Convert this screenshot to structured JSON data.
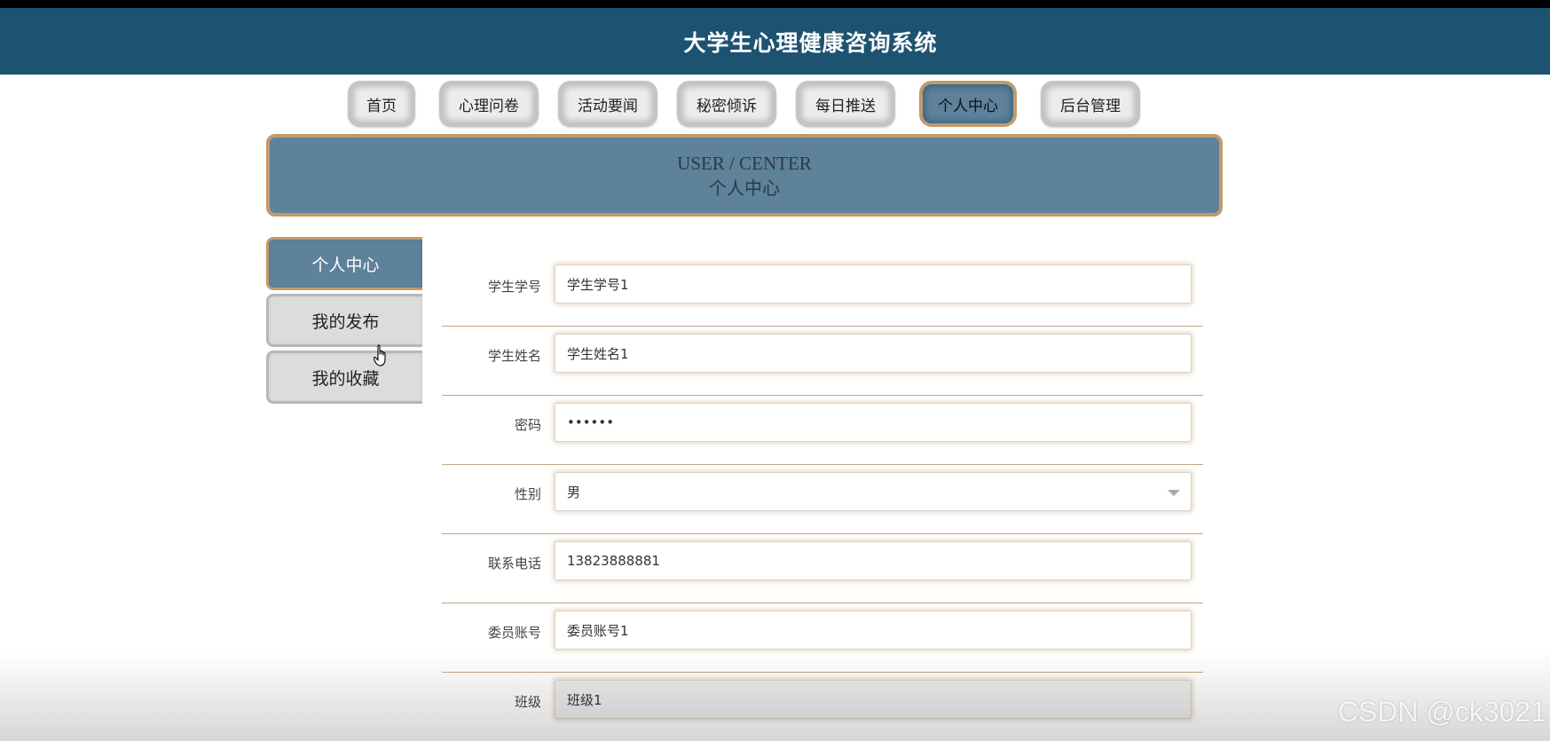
{
  "app": {
    "title": "大学生心理健康咨询系统"
  },
  "nav": {
    "items": [
      {
        "label": "首页"
      },
      {
        "label": "心理问卷"
      },
      {
        "label": "活动要闻"
      },
      {
        "label": "秘密倾诉"
      },
      {
        "label": "每日推送"
      },
      {
        "label": "个人中心",
        "active": true
      },
      {
        "label": "后台管理"
      }
    ]
  },
  "banner": {
    "en": "USER / CENTER",
    "cn": "个人中心"
  },
  "sidebar": {
    "items": [
      {
        "label": "个人中心",
        "active": true
      },
      {
        "label": "我的发布"
      },
      {
        "label": "我的收藏"
      }
    ]
  },
  "form": {
    "fields": [
      {
        "label": "学生学号",
        "value": "学生学号1"
      },
      {
        "label": "学生姓名",
        "value": "学生姓名1"
      },
      {
        "label": "密码",
        "value": "••••••"
      },
      {
        "label": "性别",
        "value": "男"
      },
      {
        "label": "联系电话",
        "value": "13823888881"
      },
      {
        "label": "委员账号",
        "value": "委员账号1"
      },
      {
        "label": "班级",
        "value": "班级1"
      }
    ]
  },
  "watermark": "CSDN @ck3021",
  "colors": {
    "header_bg": "#1d5370",
    "accent": "#5d829a",
    "border_gold": "#c19a6b"
  },
  "icons": {
    "select_caret": "chevron-down-icon",
    "cursor": "hand-pointer-icon"
  }
}
